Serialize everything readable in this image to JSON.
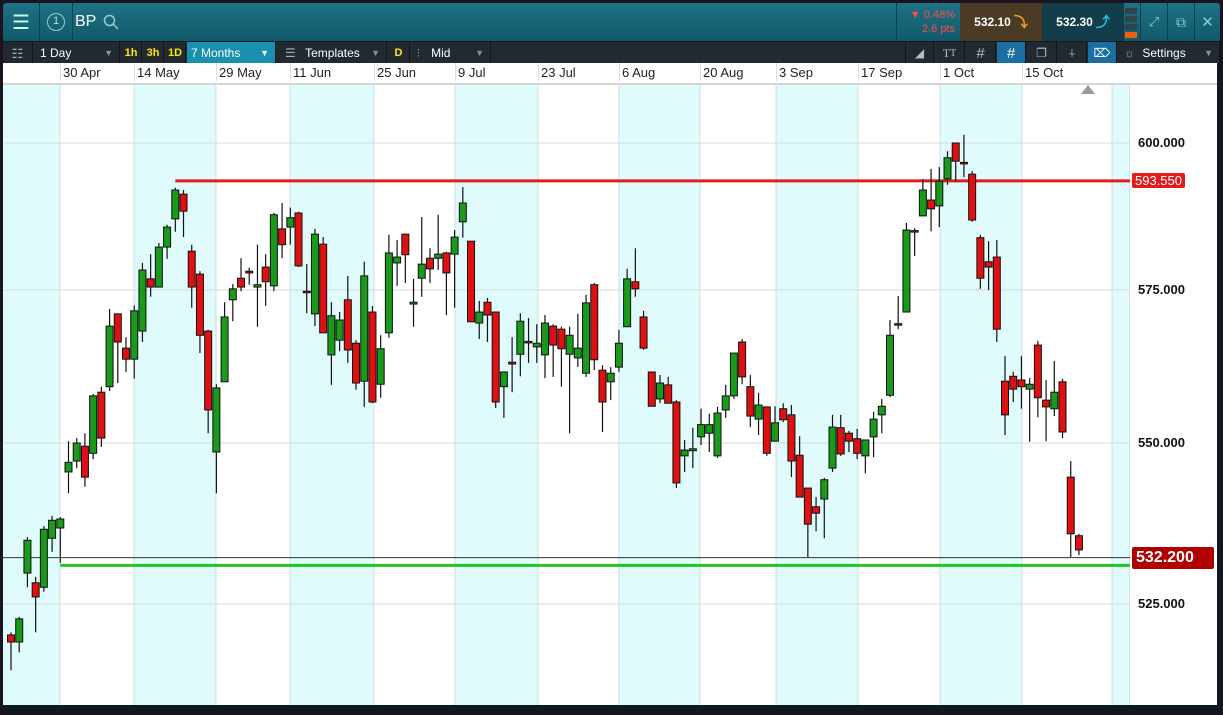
{
  "header": {
    "symbol": "BP",
    "alert_count": "1",
    "change_pct": "▼ 0.48%",
    "change_pts": "2.6 pts",
    "sell_price": "532.10",
    "buy_price": "532.30"
  },
  "toolbar": {
    "interval": "1 Day",
    "quick_intervals": [
      "1h",
      "3h",
      "1D"
    ],
    "range": "7 Months",
    "templates": "Templates",
    "d_label": "D",
    "price_type": "Mid",
    "settings": "Settings"
  },
  "date_axis": [
    "30 Apr",
    "14 May",
    "29 May",
    "11 Jun",
    "25 Jun",
    "9 Jul",
    "23 Jul",
    "6 Aug",
    "20 Aug",
    "3 Sep",
    "17 Sep",
    "1 Oct",
    "15 Oct"
  ],
  "colors": {
    "up": "#1a9a1a",
    "down": "#e01010",
    "band": "#e0fbfc",
    "resistance": "#e41b1b",
    "support": "#22c422",
    "current": "#b00000"
  },
  "chart_data": {
    "type": "candlestick",
    "title": "BP",
    "interval": "1 Day",
    "range": "7 Months",
    "y_ticks": [
      {
        "value": 600,
        "label": "600.000"
      },
      {
        "value": 575,
        "label": "575.000"
      },
      {
        "value": 550,
        "label": "550.000"
      },
      {
        "value": 525,
        "label": "525.000"
      }
    ],
    "resistance": {
      "value": 593.55,
      "label": "593.550"
    },
    "support": {
      "value": 531.0
    },
    "current": {
      "value": 532.2,
      "label": "532.200"
    },
    "ohlc": [
      [
        520.2,
        520.6,
        514.7,
        519.1
      ],
      [
        519.1,
        523.0,
        517.5,
        522.7
      ],
      [
        529.8,
        535.4,
        527.6,
        534.9
      ],
      [
        528.3,
        529.2,
        520.6,
        526.1
      ],
      [
        527.6,
        537.1,
        526.9,
        536.6
      ],
      [
        535.2,
        538.7,
        533.1,
        538.0
      ],
      [
        536.8,
        538.5,
        531.4,
        538.2
      ],
      [
        545.5,
        550.3,
        542.2,
        547.0
      ],
      [
        547.2,
        550.8,
        546.1,
        550.0
      ],
      [
        549.5,
        551.6,
        543.2,
        544.7
      ],
      [
        548.4,
        558.0,
        547.5,
        557.7
      ],
      [
        558.3,
        559.2,
        549.4,
        550.8
      ],
      [
        559.2,
        571.9,
        558.5,
        569.1
      ],
      [
        571.1,
        571.1,
        559.8,
        566.5
      ],
      [
        565.5,
        567.3,
        561.6,
        563.7
      ],
      [
        563.7,
        572.5,
        560.5,
        571.6
      ],
      [
        568.3,
        579.6,
        566.5,
        578.4
      ],
      [
        576.9,
        581.1,
        573.9,
        575.5
      ],
      [
        575.5,
        583.0,
        575.5,
        582.3
      ],
      [
        582.3,
        586.1,
        580.3,
        585.7
      ],
      [
        587.1,
        592.4,
        584.9,
        592.0
      ],
      [
        591.3,
        592.0,
        584.0,
        588.4
      ],
      [
        581.6,
        582.7,
        572.1,
        575.5
      ],
      [
        577.7,
        578.2,
        564.7,
        567.6
      ],
      [
        568.3,
        568.5,
        551.6,
        555.4
      ],
      [
        548.6,
        559.6,
        542.2,
        559.0
      ],
      [
        560.0,
        573.0,
        560.0,
        570.6
      ],
      [
        573.4,
        576.0,
        569.9,
        575.2
      ],
      [
        577.0,
        580.4,
        574.8,
        575.5
      ],
      [
        578.2,
        578.8,
        575.9,
        577.9
      ],
      [
        575.5,
        582.7,
        569.0,
        575.9
      ],
      [
        578.9,
        581.1,
        572.4,
        576.4
      ],
      [
        575.7,
        588.1,
        574.8,
        587.8
      ],
      [
        585.4,
        589.8,
        580.4,
        582.7
      ],
      [
        585.7,
        589.0,
        582.7,
        587.3
      ],
      [
        588.1,
        588.3,
        578.9,
        579.1
      ],
      [
        574.8,
        579.4,
        571.2,
        574.7
      ],
      [
        571.1,
        585.4,
        569.1,
        584.5
      ],
      [
        582.8,
        584.0,
        568.0,
        568.0
      ],
      [
        564.4,
        573.0,
        559.5,
        570.8
      ],
      [
        566.8,
        571.4,
        565.0,
        570.1
      ],
      [
        573.4,
        577.4,
        563.1,
        565.2
      ],
      [
        566.3,
        566.8,
        558.7,
        559.8
      ],
      [
        560.1,
        579.8,
        555.9,
        577.4
      ],
      [
        571.4,
        572.4,
        556.5,
        556.7
      ],
      [
        559.6,
        567.6,
        557.4,
        565.4
      ],
      [
        568.0,
        584.4,
        567.2,
        581.3
      ],
      [
        579.6,
        583.5,
        575.7,
        580.6
      ],
      [
        584.5,
        584.5,
        576.2,
        581.0
      ],
      [
        572.7,
        576.9,
        569.0,
        573.0
      ],
      [
        577.0,
        587.4,
        573.9,
        579.4
      ],
      [
        580.4,
        582.1,
        576.2,
        578.6
      ],
      [
        580.4,
        587.8,
        578.4,
        581.1
      ],
      [
        581.3,
        581.5,
        570.9,
        577.9
      ],
      [
        581.1,
        585.2,
        572.1,
        584.0
      ],
      [
        586.6,
        592.5,
        583.9,
        589.8
      ],
      [
        583.3,
        583.3,
        569.8,
        569.8
      ],
      [
        569.6,
        573.2,
        567.0,
        571.4
      ],
      [
        573.0,
        573.7,
        566.5,
        570.9
      ],
      [
        571.4,
        571.4,
        555.7,
        556.7
      ],
      [
        559.2,
        561.6,
        554.1,
        561.6
      ],
      [
        563.2,
        567.3,
        558.3,
        562.9
      ],
      [
        564.5,
        571.2,
        560.9,
        569.9
      ],
      [
        566.6,
        570.4,
        563.1,
        566.5
      ],
      [
        565.7,
        569.4,
        563.1,
        566.3
      ],
      [
        564.4,
        570.9,
        560.6,
        569.6
      ],
      [
        569.1,
        569.4,
        560.8,
        566.0
      ],
      [
        568.6,
        569.0,
        559.2,
        565.4
      ],
      [
        564.5,
        569.0,
        551.6,
        567.6
      ],
      [
        563.9,
        571.1,
        562.4,
        565.5
      ],
      [
        561.4,
        574.2,
        560.8,
        572.9
      ],
      [
        575.9,
        576.2,
        561.9,
        563.6
      ],
      [
        561.9,
        562.7,
        551.8,
        556.7
      ],
      [
        560.0,
        562.4,
        557.0,
        561.4
      ],
      [
        562.4,
        568.5,
        561.6,
        566.3
      ],
      [
        569.0,
        578.6,
        569.0,
        576.9
      ],
      [
        576.4,
        582.1,
        573.9,
        575.2
      ],
      [
        570.6,
        571.6,
        565.2,
        565.5
      ],
      [
        561.6,
        561.6,
        556.0,
        556.0
      ],
      [
        557.2,
        561.1,
        556.5,
        559.8
      ],
      [
        559.5,
        560.8,
        556.5,
        556.5
      ],
      [
        556.7,
        557.0,
        543.0,
        543.8
      ],
      [
        548.0,
        550.5,
        545.5,
        548.9
      ],
      [
        548.8,
        552.5,
        546.1,
        549.1
      ],
      [
        551.0,
        555.6,
        549.7,
        553.0
      ],
      [
        551.6,
        554.8,
        548.6,
        553.0
      ],
      [
        548.0,
        555.9,
        547.7,
        554.9
      ],
      [
        555.4,
        559.5,
        554.1,
        557.7
      ],
      [
        557.7,
        564.7,
        557.2,
        564.7
      ],
      [
        566.5,
        567.0,
        559.6,
        560.8
      ],
      [
        559.2,
        561.1,
        552.6,
        554.4
      ],
      [
        553.9,
        558.2,
        551.3,
        556.2
      ],
      [
        555.9,
        555.9,
        548.0,
        548.4
      ],
      [
        550.3,
        556.0,
        550.3,
        553.3
      ],
      [
        555.6,
        556.5,
        553.4,
        553.8
      ],
      [
        554.6,
        556.2,
        544.7,
        547.2
      ],
      [
        548.1,
        551.1,
        541.6,
        541.6
      ],
      [
        543.0,
        543.0,
        532.3,
        537.4
      ],
      [
        540.1,
        541.6,
        536.3,
        539.1
      ],
      [
        541.3,
        544.6,
        535.2,
        544.3
      ],
      [
        546.1,
        554.6,
        545.5,
        552.6
      ],
      [
        552.5,
        554.6,
        548.0,
        548.3
      ],
      [
        551.6,
        552.0,
        548.6,
        550.3
      ],
      [
        550.7,
        552.3,
        547.5,
        548.4
      ],
      [
        548.0,
        550.5,
        545.3,
        550.5
      ],
      [
        551.0,
        555.1,
        547.8,
        553.9
      ],
      [
        554.6,
        557.2,
        551.6,
        556.0
      ],
      [
        557.8,
        570.1,
        557.5,
        567.6
      ],
      [
        569.5,
        574.0,
        568.6,
        569.4
      ],
      [
        571.4,
        586.4,
        571.4,
        585.2
      ],
      [
        585.1,
        585.5,
        580.8,
        585.0
      ],
      [
        587.6,
        593.9,
        587.6,
        592.0
      ],
      [
        590.3,
        595.6,
        585.0,
        588.8
      ],
      [
        589.3,
        595.9,
        585.7,
        593.5
      ],
      [
        593.9,
        598.6,
        592.9,
        597.5
      ],
      [
        600.0,
        600.0,
        593.4,
        596.9
      ],
      [
        596.7,
        601.4,
        594.2,
        596.6
      ],
      [
        594.7,
        595.2,
        586.6,
        586.9
      ],
      [
        583.9,
        584.4,
        575.2,
        577.0
      ],
      [
        579.8,
        583.3,
        575.0,
        578.9
      ],
      [
        580.6,
        583.5,
        566.5,
        568.6
      ],
      [
        560.1,
        564.2,
        551.3,
        554.6
      ],
      [
        560.9,
        561.6,
        556.7,
        558.8
      ],
      [
        560.3,
        564.2,
        555.6,
        559.2
      ],
      [
        558.8,
        560.6,
        550.2,
        559.6
      ],
      [
        566.0,
        566.7,
        554.2,
        557.4
      ],
      [
        557.0,
        560.3,
        550.3,
        555.9
      ],
      [
        555.6,
        563.4,
        554.4,
        558.3
      ],
      [
        560.0,
        560.5,
        550.8,
        551.8
      ],
      [
        544.7,
        547.2,
        532.3,
        535.9
      ],
      [
        535.6,
        535.9,
        532.6,
        533.4
      ]
    ]
  }
}
